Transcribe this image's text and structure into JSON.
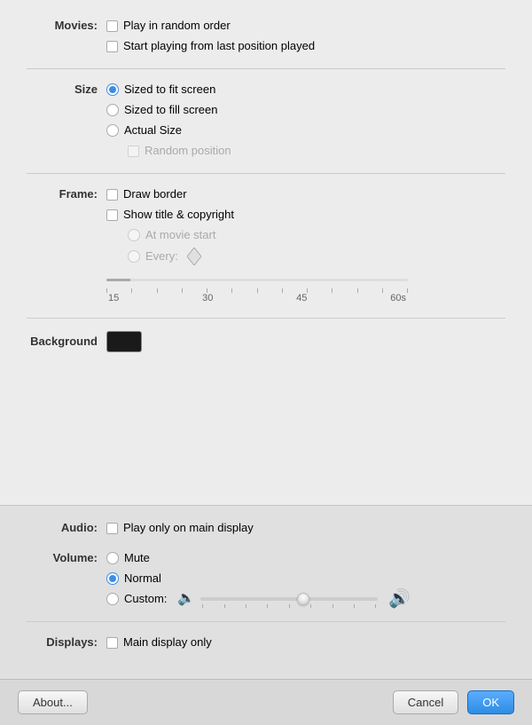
{
  "movies": {
    "label": "Movies:",
    "option1": "Play in random order",
    "option2": "Start playing from last position played"
  },
  "size": {
    "label": "Size",
    "option1": "Sized to fit screen",
    "option2": "Sized to fill screen",
    "option3": "Actual Size",
    "option4": "Random position",
    "selected": "fit"
  },
  "frame": {
    "label": "Frame:",
    "option1": "Draw border",
    "option2": "Show title & copyright",
    "sub1": "At movie start",
    "sub2": "Every:",
    "slider_labels": [
      "15",
      "30",
      "45",
      "60s"
    ]
  },
  "background": {
    "label": "Background"
  },
  "audio": {
    "label": "Audio:",
    "option1": "Play only on main display"
  },
  "volume": {
    "label": "Volume:",
    "option1": "Mute",
    "option2": "Normal",
    "option3": "Custom:"
  },
  "displays": {
    "label": "Displays:",
    "option1": "Main display only"
  },
  "buttons": {
    "about": "About...",
    "cancel": "Cancel",
    "ok": "OK"
  }
}
